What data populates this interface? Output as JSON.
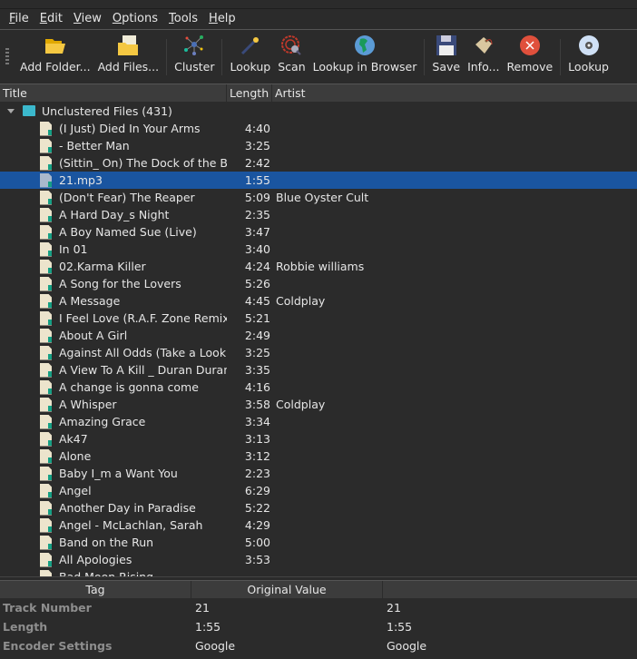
{
  "menu": [
    "File",
    "Edit",
    "View",
    "Options",
    "Tools",
    "Help"
  ],
  "toolbar": {
    "add_folder": "Add Folder...",
    "add_files": "Add Files...",
    "cluster": "Cluster",
    "lookup": "Lookup",
    "scan": "Scan",
    "lookup_browser": "Lookup in Browser",
    "save": "Save",
    "info": "Info...",
    "remove": "Remove",
    "lookup_cd": "Lookup"
  },
  "columns": {
    "title": "Title",
    "length": "Length",
    "artist": "Artist"
  },
  "group": {
    "label": "Unclustered Files (431)"
  },
  "selected_index": 3,
  "files": [
    {
      "title": "(I Just) Died In Your Arms",
      "length": "4:40",
      "artist": ""
    },
    {
      "title": "- Better Man",
      "length": "3:25",
      "artist": ""
    },
    {
      "title": "(Sittin_ On) The Dock of the B...",
      "length": "2:42",
      "artist": ""
    },
    {
      "title": "21.mp3",
      "length": "1:55",
      "artist": ""
    },
    {
      "title": "(Don't Fear) The Reaper",
      "length": "5:09",
      "artist": "Blue Oyster Cult"
    },
    {
      "title": "A Hard Day_s Night",
      "length": "2:35",
      "artist": ""
    },
    {
      "title": "A Boy Named Sue (Live)",
      "length": "3:47",
      "artist": ""
    },
    {
      "title": "In 01",
      "length": "3:40",
      "artist": ""
    },
    {
      "title": "02.Karma Killer",
      "length": "4:24",
      "artist": "Robbie williams"
    },
    {
      "title": "A Song for the Lovers",
      "length": "5:26",
      "artist": ""
    },
    {
      "title": "A Message",
      "length": "4:45",
      "artist": "Coldplay"
    },
    {
      "title": "I Feel Love (R.A.F. Zone Remix)...",
      "length": "5:21",
      "artist": ""
    },
    {
      "title": "About A Girl",
      "length": "2:49",
      "artist": ""
    },
    {
      "title": "Against All Odds (Take a Look ...",
      "length": "3:25",
      "artist": ""
    },
    {
      "title": "A View To A Kill _ Duran Duran",
      "length": "3:35",
      "artist": ""
    },
    {
      "title": "A change is gonna come",
      "length": "4:16",
      "artist": ""
    },
    {
      "title": "A Whisper",
      "length": "3:58",
      "artist": "Coldplay"
    },
    {
      "title": "Amazing Grace",
      "length": "3:34",
      "artist": ""
    },
    {
      "title": "Ak47",
      "length": "3:13",
      "artist": ""
    },
    {
      "title": "Alone",
      "length": "3:12",
      "artist": ""
    },
    {
      "title": "Baby I_m a Want You",
      "length": "2:23",
      "artist": ""
    },
    {
      "title": "Angel",
      "length": "6:29",
      "artist": ""
    },
    {
      "title": "Another Day in Paradise",
      "length": "5:22",
      "artist": ""
    },
    {
      "title": "Angel - McLachlan, Sarah",
      "length": "4:29",
      "artist": ""
    },
    {
      "title": "Band on the Run",
      "length": "5:00",
      "artist": ""
    },
    {
      "title": "All Apologies",
      "length": "3:53",
      "artist": ""
    },
    {
      "title": "Bad Moon Rising",
      "length": "",
      "artist": ""
    }
  ],
  "metadata": {
    "headers": [
      "Tag",
      "Original Value",
      ""
    ],
    "rows": [
      {
        "tag": "Track Number",
        "original": "21",
        "new": "21"
      },
      {
        "tag": "Length",
        "original": "1:55",
        "new": "1:55"
      },
      {
        "tag": "Encoder Settings",
        "original": "Google",
        "new": "Google"
      }
    ]
  },
  "colors": {
    "background": "#2b2b2b",
    "selection": "#1a55a0",
    "header": "#3c3c3c"
  }
}
